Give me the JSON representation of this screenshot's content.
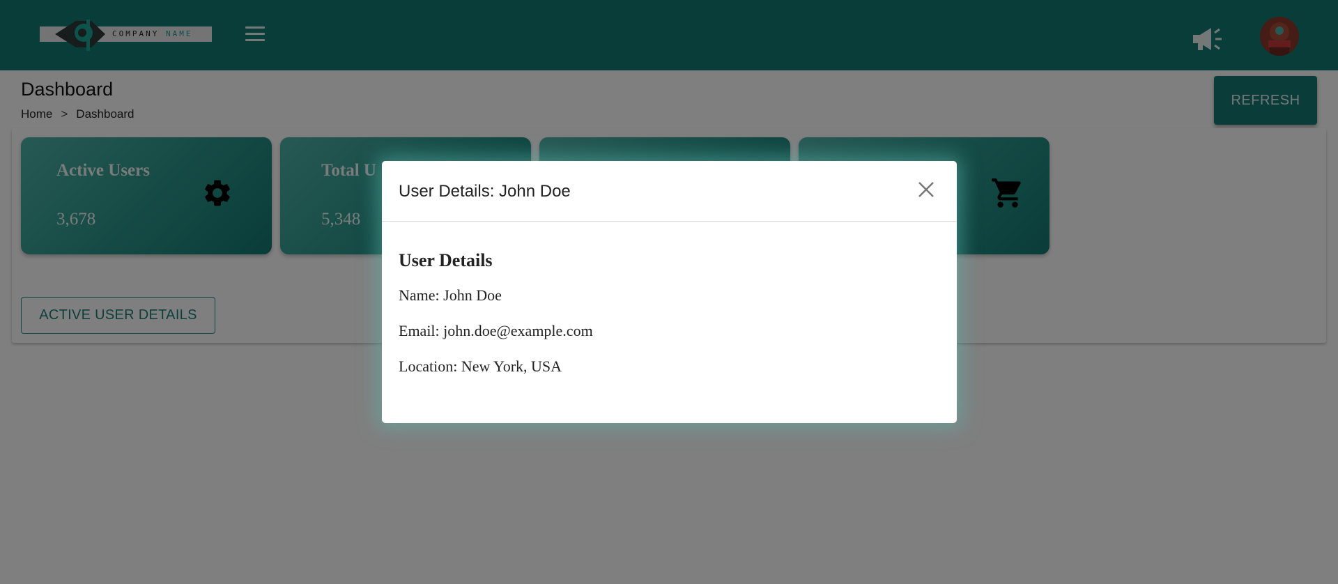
{
  "header": {
    "logo": {
      "word1": "COMPANY",
      "word2": "NAME"
    },
    "menu_icon": "hamburger-menu-icon",
    "announcement_icon": "megaphone-icon",
    "avatar_icon": "user-avatar"
  },
  "page": {
    "title": "Dashboard",
    "breadcrumb": [
      "Home",
      ">",
      "Dashboard"
    ],
    "refresh_label": "REFRESH"
  },
  "cards": [
    {
      "title": "Active Users",
      "value": "3,678",
      "icon": "gear-icon"
    },
    {
      "title": "Total U",
      "value": "5,348",
      "icon": ""
    },
    {
      "title": "",
      "value": "",
      "icon": ""
    },
    {
      "title": "",
      "value": "",
      "icon": "cart-icon"
    }
  ],
  "active_user_details_label": "ACTIVE USER DETAILS",
  "modal": {
    "title": "User Details: John Doe",
    "heading": "User Details",
    "name_line": "Name: John Doe",
    "email_line": "Email: john.doe@example.com",
    "location_line": "Location: New York, USA",
    "close_icon": "close-icon"
  },
  "colors": {
    "topbar": "#137a74",
    "accent": "#147a72",
    "card_light": "#4fb3a8",
    "card_dark": "#137a72"
  }
}
